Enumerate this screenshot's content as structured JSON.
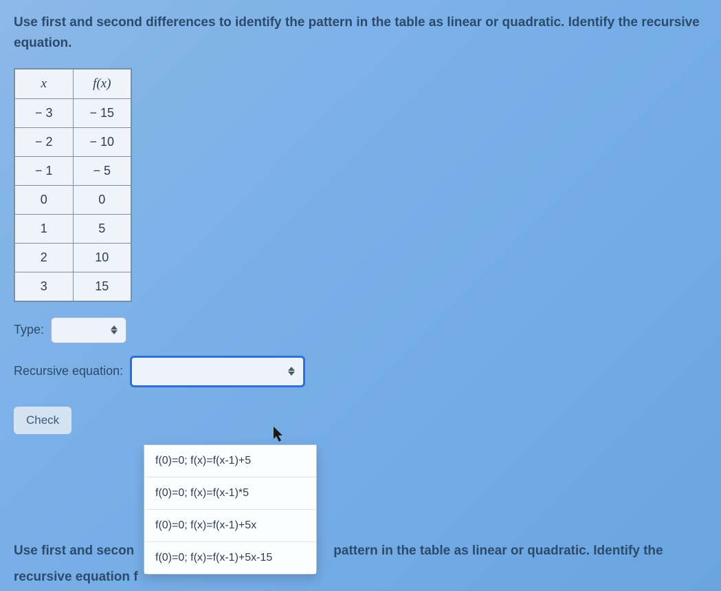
{
  "prompt": "Use first and second differences to identify the pattern in the table as linear or quadratic. Identify the recursive equation.",
  "table": {
    "head": {
      "c0": "x",
      "c1": "f(x)"
    },
    "rows": [
      {
        "c0": "− 3",
        "c1": "− 15"
      },
      {
        "c0": "− 2",
        "c1": "− 10"
      },
      {
        "c0": "− 1",
        "c1": "− 5"
      },
      {
        "c0": "0",
        "c1": "0"
      },
      {
        "c0": "1",
        "c1": "5"
      },
      {
        "c0": "2",
        "c1": "10"
      },
      {
        "c0": "3",
        "c1": "15"
      }
    ]
  },
  "type_label": "Type:",
  "type_value": "",
  "recursive_label": "Recursive equation:",
  "recursive_value": "",
  "check_label": "Check",
  "dropdown": {
    "options": [
      "f(0)=0; f(x)=f(x-1)+5",
      "f(0)=0; f(x)=f(x-1)*5",
      "f(0)=0; f(x)=f(x-1)+5x",
      "f(0)=0; f(x)=f(x-1)+5x-15"
    ]
  },
  "second_prompt": {
    "line1_left": "Use first and secon",
    "line1_right": "pattern in the table as linear or quadratic. Identify the",
    "line2": "recursive equation f"
  }
}
